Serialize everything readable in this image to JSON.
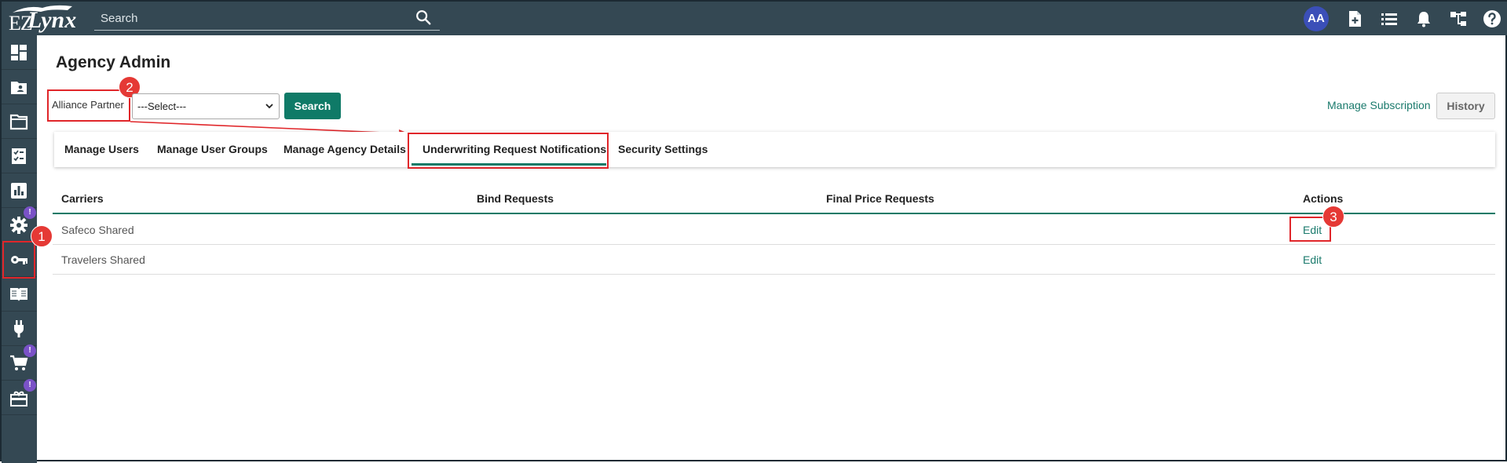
{
  "app": {
    "logo_text_ez": "EZ",
    "logo_text_lynx": "Lynx",
    "search_placeholder": "Search",
    "avatar_initials": "AA"
  },
  "sidebar": {
    "items": [
      {
        "icon": "dashboard-icon"
      },
      {
        "icon": "contact-folder-icon"
      },
      {
        "icon": "folder-icon"
      },
      {
        "icon": "tasks-icon"
      },
      {
        "icon": "reports-icon"
      },
      {
        "icon": "settings-icon",
        "badge": "!"
      },
      {
        "icon": "key-icon"
      },
      {
        "icon": "book-icon"
      },
      {
        "icon": "plug-icon"
      },
      {
        "icon": "cart-icon",
        "badge": "!"
      },
      {
        "icon": "gift-icon",
        "badge": "!"
      }
    ]
  },
  "page": {
    "title": "Agency Admin",
    "alliance_label": "Alliance Partner",
    "select_value": "---Select---",
    "search_button": "Search",
    "manage_subscription": "Manage Subscription",
    "history_button": "History"
  },
  "tabs": [
    "Manage Users",
    "Manage User Groups",
    "Manage Agency Details",
    "Underwriting Request Notifications",
    "Security Settings"
  ],
  "table": {
    "headers": [
      "Carriers",
      "Bind Requests",
      "Final Price Requests",
      "Actions"
    ],
    "rows": [
      {
        "carrier": "Safeco Shared",
        "bind": "",
        "final": "",
        "action": "Edit"
      },
      {
        "carrier": "Travelers Shared",
        "bind": "",
        "final": "",
        "action": "Edit"
      }
    ]
  },
  "callouts": [
    "1",
    "2",
    "3"
  ],
  "colors": {
    "topbar": "#344853",
    "accent": "#0f7a67",
    "annotation_red": "#e0262a",
    "badge": "#7a52c7",
    "avatar": "#3b4fb8"
  }
}
